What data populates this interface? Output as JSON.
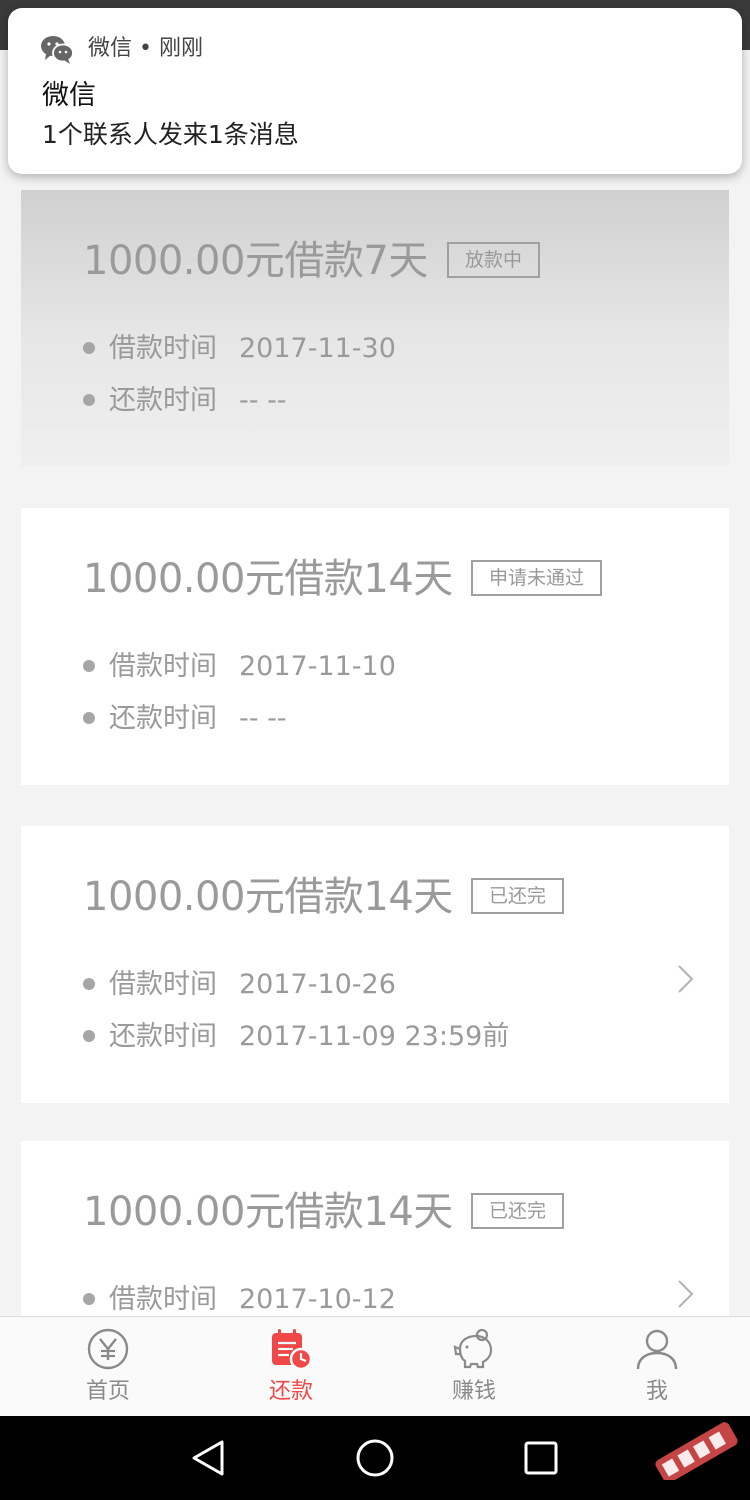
{
  "notification": {
    "app_name": "微信",
    "separator": " • ",
    "time": "刚刚",
    "title": "微信",
    "body": "1个联系人发来1条消息",
    "icon": "wechat-icon"
  },
  "loans": [
    {
      "title": "1000.00元借款7天",
      "status": "放款中",
      "borrow_label": "借款时间",
      "borrow_date": "2017-11-30",
      "repay_label": "还款时间",
      "repay_date": "-- --",
      "has_chevron": false
    },
    {
      "title": "1000.00元借款14天",
      "status": "申请未通过",
      "borrow_label": "借款时间",
      "borrow_date": "2017-11-10",
      "repay_label": "还款时间",
      "repay_date": "-- --",
      "has_chevron": false
    },
    {
      "title": "1000.00元借款14天",
      "status": "已还完",
      "borrow_label": "借款时间",
      "borrow_date": "2017-10-26",
      "repay_label": "还款时间",
      "repay_date": "2017-11-09 23:59前",
      "has_chevron": true
    },
    {
      "title": "1000.00元借款14天",
      "status": "已还完",
      "borrow_label": "借款时间",
      "borrow_date": "2017-10-12",
      "repay_label": "还款时间",
      "repay_date": "",
      "has_chevron": true
    }
  ],
  "tabs": [
    {
      "label": "首页",
      "icon": "yen-coin-icon",
      "active": false
    },
    {
      "label": "还款",
      "icon": "calendar-clock-icon",
      "active": true
    },
    {
      "label": "赚钱",
      "icon": "piggy-bank-icon",
      "active": false
    },
    {
      "label": "我",
      "icon": "user-icon",
      "active": false
    }
  ],
  "colors": {
    "accent": "#f04848",
    "inactive": "#8a8a8a",
    "card_text": "#9a9a9a"
  }
}
